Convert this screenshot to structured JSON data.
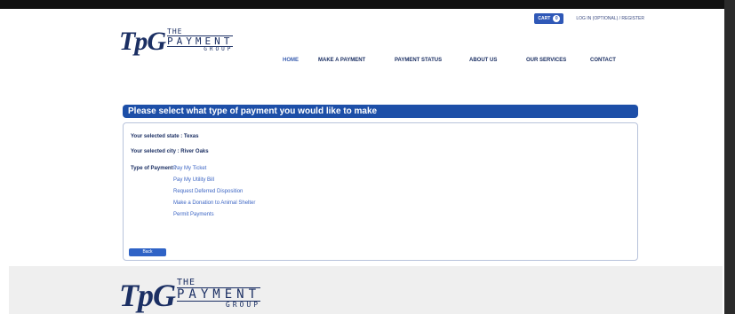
{
  "header": {
    "cart_label": "CART",
    "cart_count": "0",
    "login_link": "LOG IN (OPTIONAL) / REGISTER"
  },
  "logo": {
    "mark": "TpG",
    "line1": "THE",
    "line2": "PAYMENT",
    "line3": "GROUP"
  },
  "nav": {
    "home": "HOME",
    "make_payment": "MAKE A PAYMENT",
    "payment_status": "PAYMENT STATUS",
    "about_us": "ABOUT US",
    "our_services": "OUR SERVICES",
    "contact": "CONTACT"
  },
  "main": {
    "title": "Please select what type of payment you would like to make",
    "state_line": "Your selected state : Texas",
    "city_line": "Your selected city : River Oaks",
    "type_label": "Type of Payment :",
    "payment_types": [
      "Pay My Ticket",
      "Pay My Utility Bill",
      "Request Deferred Disposition",
      "Make a Donation to Animal Shelter",
      "Permit Payments"
    ],
    "back_button": "Back"
  },
  "colors": {
    "brand_blue": "#1d4fa8",
    "navy_text": "#1b2f63",
    "link_blue": "#3d66c4",
    "footer_bg": "#efefef"
  }
}
